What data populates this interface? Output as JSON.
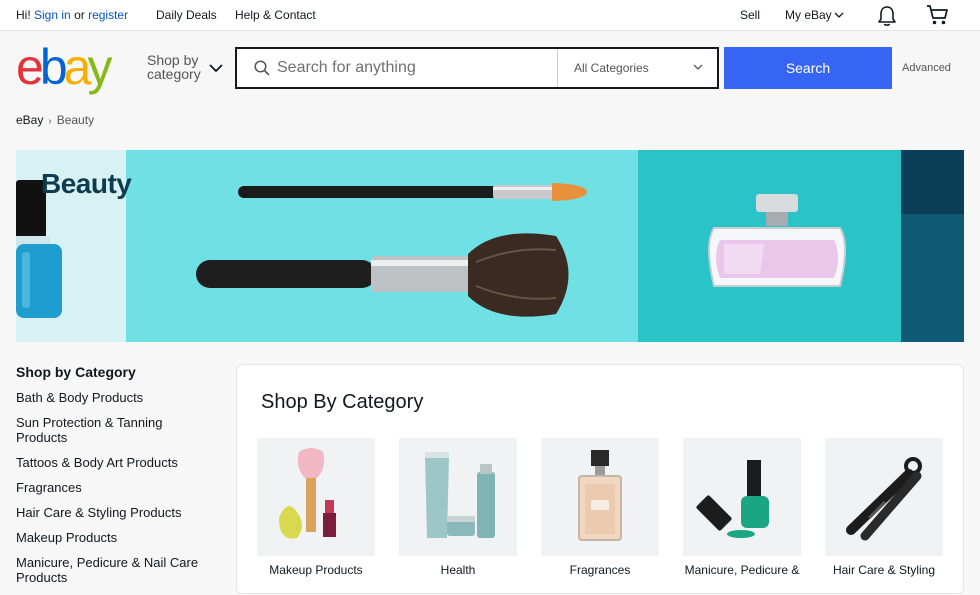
{
  "topnav": {
    "greeting_prefix": "Hi!",
    "sign_in": "Sign in",
    "or": "or",
    "register": "register",
    "daily_deals": "Daily Deals",
    "help_contact": "Help & Contact",
    "sell": "Sell",
    "my_ebay": "My eBay"
  },
  "header": {
    "logo_letters": [
      "e",
      "b",
      "a",
      "y"
    ],
    "logo_colors": [
      "#e53238",
      "#0064d2",
      "#f5af02",
      "#86b817"
    ],
    "shop_by_line1": "Shop by",
    "shop_by_line2": "category",
    "search_placeholder": "Search for anything",
    "category_select": "All Categories",
    "search_button": "Search",
    "advanced": "Advanced"
  },
  "breadcrumb": {
    "items": [
      "eBay",
      "Beauty"
    ]
  },
  "banner": {
    "title": "Beauty"
  },
  "sidebar": {
    "heading": "Shop by Category",
    "items": [
      "Bath & Body Products",
      "Sun Protection & Tanning Products",
      "Tattoos & Body Art Products",
      "Fragrances",
      "Hair Care & Styling Products",
      "Makeup Products",
      "Manicure, Pedicure & Nail Care Products"
    ]
  },
  "main": {
    "heading": "Shop By Category",
    "tiles": [
      {
        "label": "Makeup Products",
        "icon": "makeup-products-image"
      },
      {
        "label": "Health",
        "icon": "health-products-image"
      },
      {
        "label": "Fragrances",
        "icon": "fragrance-bottle-image"
      },
      {
        "label": "Manicure, Pedicure &",
        "icon": "nail-polish-image"
      },
      {
        "label": "Hair Care & Styling",
        "icon": "hair-straightener-image"
      }
    ]
  },
  "colors": {
    "accent": "#3665f3",
    "link": "#0654ba",
    "banner_bg": "#6fe0e3"
  }
}
